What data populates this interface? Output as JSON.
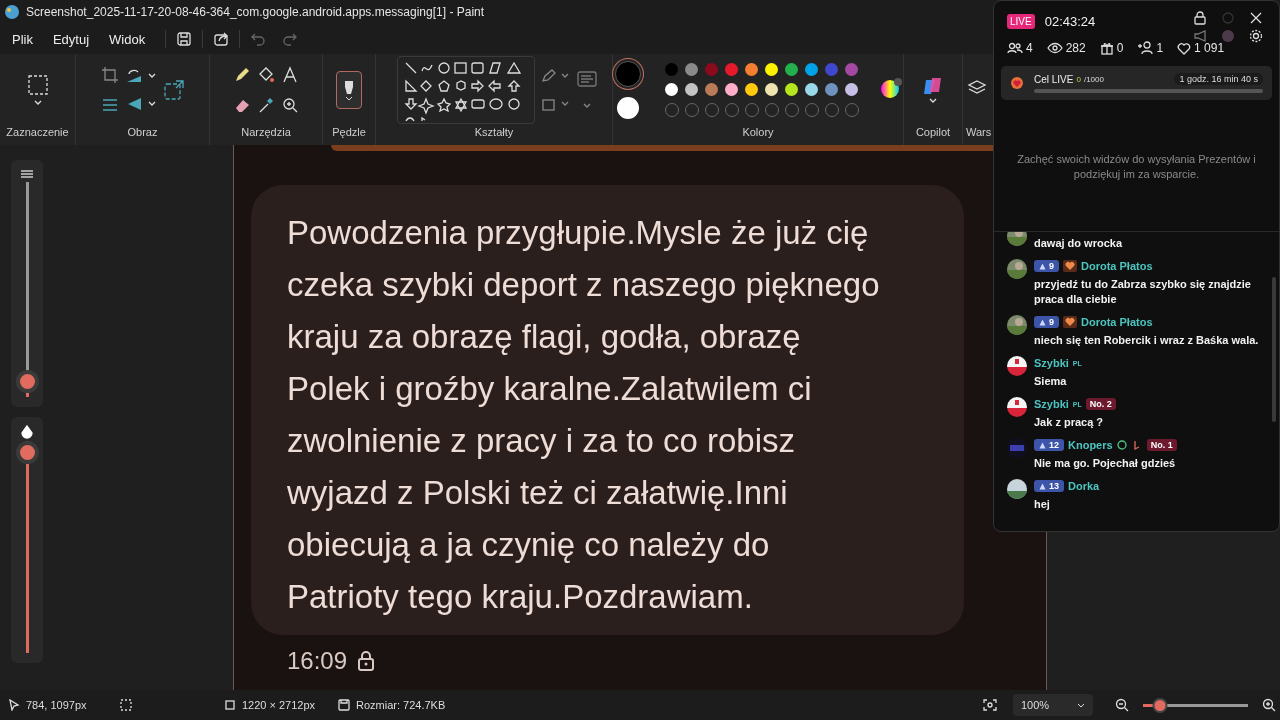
{
  "window": {
    "title": "Screenshot_2025-11-17-20-08-46-364_com.google.android.apps.messaging[1] - Paint"
  },
  "menu": [
    {
      "label": "Plik"
    },
    {
      "label": "Edytuj"
    },
    {
      "label": "Widok"
    }
  ],
  "ribbon": [
    {
      "kind": "selection",
      "label": "Zaznaczenie"
    },
    {
      "kind": "image",
      "label": "Obraz"
    },
    {
      "kind": "tools",
      "label": "Narzędzia"
    },
    {
      "kind": "brushes",
      "label": "Pędzle"
    },
    {
      "kind": "shapes",
      "label": "Kształty"
    },
    {
      "kind": "colors",
      "label": "Kolory"
    },
    {
      "kind": "copilot",
      "label": "Copilot"
    },
    {
      "kind": "layers",
      "label": "Wars"
    }
  ],
  "colors": {
    "current": [
      {
        "color": "#000000"
      },
      {
        "color": "#ffffff"
      }
    ],
    "swatches": [
      {
        "color": "#000000"
      },
      {
        "color": "#8a8a8a"
      },
      {
        "color": "#8b0a1e"
      },
      {
        "color": "#e61a2b"
      },
      {
        "color": "#f47f30"
      },
      {
        "color": "#fff200"
      },
      {
        "color": "#22b14c"
      },
      {
        "color": "#00a2e8"
      },
      {
        "color": "#3f48cc"
      },
      {
        "color": "#a349a4"
      },
      {
        "color": "#ffffff"
      },
      {
        "color": "#c3c3c3"
      },
      {
        "color": "#b97a57"
      },
      {
        "color": "#ffaec9"
      },
      {
        "color": "#ffc90e"
      },
      {
        "color": "#efe4b0"
      },
      {
        "color": "#b5e61d"
      },
      {
        "color": "#99d9ea"
      },
      {
        "color": "#7092be"
      },
      {
        "color": "#c8bfe7"
      }
    ]
  },
  "tool_sliders": [
    {
      "kind": "size",
      "level": 0.02
    },
    {
      "kind": "opacity",
      "level": 1
    }
  ],
  "canvas": {
    "message_lines": [
      "Powodzenia przygłupie.Mysle że już cię",
      "czeka szybki deport z naszego pięknego",
      "kraju za obrazę flagi, godła, obrazę",
      "Polek i groźby karalne.Zalatwilem ci",
      "zwolnienie z pracy i za to co robisz",
      "wyjazd z Polski też ci załatwię.Inni",
      "obiecują a ja czynię co należy do",
      "Patrioty tego kraju.Pozdrawiam."
    ],
    "time": "16:09"
  },
  "status_bar": {
    "cursor": "784, 1097px",
    "canvas_size": "1220 × 2712px",
    "file_size": "Rozmiar: 724.7KB",
    "zoom": "100%",
    "zoom_level": {
      "level": 0.16
    }
  },
  "live_overlay": {
    "badge": "LIVE",
    "timer": "02:43:24",
    "stats": [
      {
        "kind": "viewers",
        "value": "4"
      },
      {
        "kind": "views",
        "value": "282"
      },
      {
        "kind": "gifts",
        "value": "0"
      },
      {
        "kind": "follows",
        "value": "1"
      },
      {
        "kind": "likes",
        "value": "1 091"
      }
    ],
    "goal": {
      "title": "Cel LIVE",
      "current": "0",
      "target": "/1000",
      "remaining": "1 godz. 16 min 40 s",
      "level": 0
    },
    "prompt": "Zachęć swoich widzów do wysyłania Prezentów i podziękuj im za wsparcie.",
    "chat": [
      {
        "kind": "cut",
        "avatar": {
          "kind": "photo"
        },
        "text": "dawaj do wrocka"
      },
      {
        "kind": "full",
        "avatar": {
          "kind": "photo"
        },
        "level": "9",
        "fan": true,
        "name": "Dorota Płatos",
        "text": "przyjedź tu do Zabrza szybko się znajdzie praca dla ciebie"
      },
      {
        "kind": "full",
        "avatar": {
          "kind": "photo"
        },
        "level": "9",
        "fan": true,
        "name": "Dorota Płatos",
        "text": "niech się ten Robercik i wraz z Baśka wala."
      },
      {
        "kind": "full",
        "avatar": {
          "kind": "flag"
        },
        "name": "Szybki",
        "tag": "PL",
        "text": "Siema"
      },
      {
        "kind": "full",
        "avatar": {
          "kind": "flag"
        },
        "name": "Szybki",
        "tag": "PL",
        "rank": "No. 2",
        "text": "Jak z pracą ?"
      },
      {
        "kind": "full",
        "avatar": {
          "kind": "logo"
        },
        "level": "12",
        "name": "Knopers",
        "extra_icons": true,
        "rank": "No. 1",
        "text": "Nie ma go. Pojechał gdzieś"
      },
      {
        "kind": "full",
        "avatar": {
          "kind": "landscape"
        },
        "level": "13",
        "name": "Dorka",
        "text": "hej"
      }
    ]
  }
}
